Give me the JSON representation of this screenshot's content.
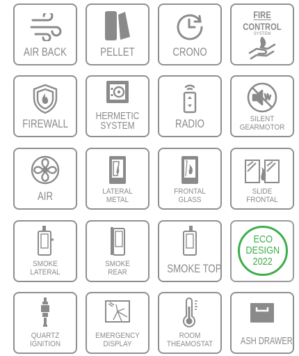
{
  "colors": {
    "tile_border": "#8f8f8f",
    "text": "#8a8a8a",
    "eco_green": "#3cae49"
  },
  "tiles": [
    {
      "id": "air-back",
      "lines": [
        "AIR BACK"
      ],
      "icon": "wind-icon"
    },
    {
      "id": "pellet",
      "lines": [
        "PELLET"
      ],
      "icon": "pellet-swatches-icon"
    },
    {
      "id": "crono",
      "lines": [
        "CRONO"
      ],
      "icon": "clock-icon"
    },
    {
      "id": "fire-control",
      "title": [
        "FIRE",
        "CONTROL",
        "SYSTEM"
      ],
      "icon": "hand-flame-icon"
    },
    {
      "id": "firewall",
      "lines": [
        "FIREWALL"
      ],
      "icon": "shield-flame-icon"
    },
    {
      "id": "hermetic-system",
      "lines": [
        "HERMETIC",
        "SYSTEM"
      ],
      "icon": "safe-icon"
    },
    {
      "id": "radio",
      "lines": [
        "RADIO"
      ],
      "icon": "remote-control-icon"
    },
    {
      "id": "silent-gearmotor",
      "lines": [
        "SILENT",
        "GEARMOTOR"
      ],
      "icon": "muted-speaker-icon"
    },
    {
      "id": "air",
      "lines": [
        "AIR"
      ],
      "icon": "fan-icon"
    },
    {
      "id": "lateral-metal",
      "lines": [
        "LATERAL",
        "METAL"
      ],
      "icon": "stove-lateral-icon"
    },
    {
      "id": "frontal-glass",
      "lines": [
        "FRONTAL",
        "GLASS"
      ],
      "icon": "stove-front-icon"
    },
    {
      "id": "slide-frontal",
      "lines": [
        "SLIDE",
        "FRONTAL"
      ],
      "icon": "sliding-glass-icon"
    },
    {
      "id": "smoke-lateral",
      "lines": [
        "SMOKE",
        "LATERAL"
      ],
      "icon": "smoke-lateral-icon"
    },
    {
      "id": "smoke-rear",
      "lines": [
        "SMOKE",
        "REAR"
      ],
      "icon": "smoke-rear-icon"
    },
    {
      "id": "smoke-top",
      "lines": [
        "SMOKE TOP"
      ],
      "icon": "smoke-top-icon"
    },
    {
      "id": "eco-design",
      "lines": [
        "ECO",
        "DESIGN",
        "2022"
      ],
      "icon": "eco-badge-icon"
    },
    {
      "id": "quartz-ignition",
      "lines": [
        "QUARTZ",
        "IGNITION"
      ],
      "icon": "igniter-icon"
    },
    {
      "id": "emergency-display",
      "lines": [
        "EMERGENCY",
        "DISPLAY"
      ],
      "icon": "cracked-display-icon"
    },
    {
      "id": "room-theamostat",
      "lines": [
        "ROOM",
        "THEAMOSTAT"
      ],
      "icon": "thermometer-icon"
    },
    {
      "id": "ash-drawer",
      "lines": [
        "ASH DRAWER"
      ],
      "icon": "drawer-icon"
    }
  ]
}
